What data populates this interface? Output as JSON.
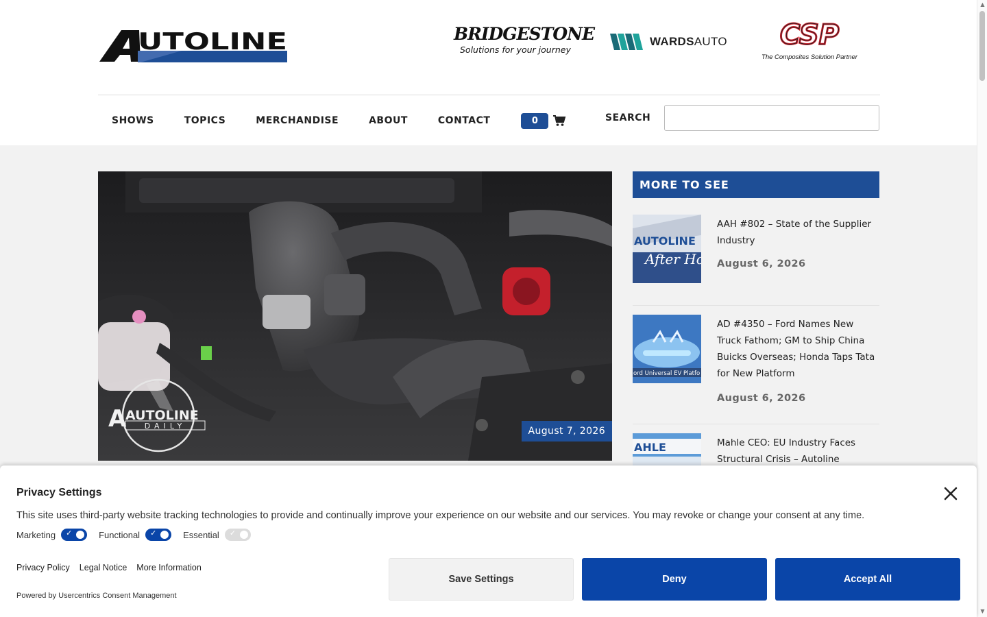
{
  "header": {
    "logo_text": "AUTOLINE",
    "sponsors": {
      "bridgestone_name": "BRIDGESTONE",
      "bridgestone_tagline": "Solutions for your journey",
      "wards_bold": "WARDS",
      "wards_light": "AUTO",
      "csp_name": "CSP",
      "csp_tagline": "The Composites Solution Partner"
    }
  },
  "nav": {
    "items": [
      "SHOWS",
      "TOPICS",
      "MERCHANDISE",
      "ABOUT",
      "CONTACT"
    ],
    "cart_count": "0",
    "search_label": "SEARCH",
    "search_value": ""
  },
  "hero": {
    "date": "August 7, 2026",
    "watermark": "AUTOLINE",
    "watermark_sub": "DAILY"
  },
  "sidebar": {
    "title": "MORE TO SEE",
    "items": [
      {
        "title": "AAH #802 – State of the Supplier Industry",
        "date": "August 6, 2026",
        "thumb_text": "AUTOLINE"
      },
      {
        "title": "AD #4350 – Ford Names New Truck Fathom; GM to Ship China Buicks Overseas; Honda Taps Tata for New Platform",
        "date": "August 6, 2026",
        "thumb_text": "ord Universal EV Platfo"
      },
      {
        "title": "Mahle CEO: EU Industry Faces Structural Crisis – Autoline",
        "date": "",
        "thumb_text": "AHLE"
      }
    ]
  },
  "consent": {
    "title": "Privacy Settings",
    "text": "This site uses third-party website tracking technologies to provide and continually improve your experience on our website and our services. You may revoke or change your consent at any time.",
    "toggles": [
      {
        "label": "Marketing",
        "on": true
      },
      {
        "label": "Functional",
        "on": true
      },
      {
        "label": "Essential",
        "on": true,
        "disabled": true
      }
    ],
    "links": [
      "Privacy Policy",
      "Legal Notice",
      "More Information"
    ],
    "powered_by": "Powered by Usercentrics Consent Management",
    "buttons": {
      "save": "Save Settings",
      "deny": "Deny",
      "accept": "Accept All"
    }
  },
  "colors": {
    "brand_blue": "#1e4e96",
    "consent_blue": "#0a45a8"
  }
}
